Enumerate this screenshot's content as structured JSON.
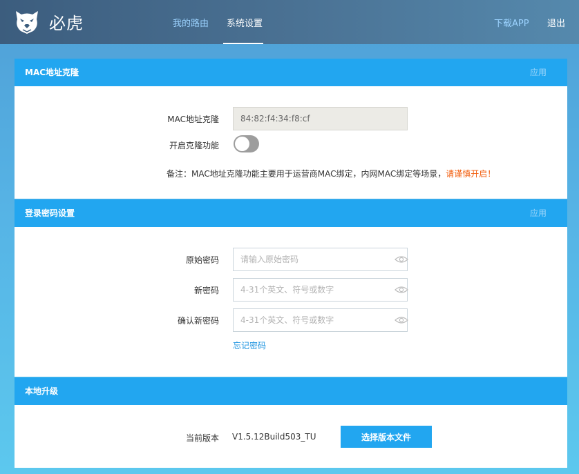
{
  "header": {
    "brand": "必虎",
    "nav": [
      "我的路由",
      "系统设置"
    ],
    "active_nav": "系统设置",
    "download_app": "下载APP",
    "logout": "退出"
  },
  "mac_panel": {
    "title": "MAC地址克隆",
    "apply": "应用",
    "mac_label": "MAC地址克隆",
    "mac_value": "84:82:f4:34:f8:cf",
    "clone_label": "开启克隆功能",
    "clone_enabled": false,
    "note_prefix": "备注：MAC地址克隆功能主要用于运营商MAC绑定，内网MAC绑定等场景，",
    "note_warning": "请谨慎开启！"
  },
  "password_panel": {
    "title": "登录密码设置",
    "apply": "应用",
    "old_label": "原始密码",
    "old_placeholder": "请输入原始密码",
    "new_label": "新密码",
    "new_placeholder": "4-31个英文、符号或数字",
    "confirm_label": "确认新密码",
    "confirm_placeholder": "4-31个英文、符号或数字",
    "forgot": "忘记密码"
  },
  "upgrade_panel": {
    "title": "本地升级",
    "version_label": "当前版本",
    "version_value": "V1.5.12Build503_TU",
    "choose_file": "选择版本文件"
  },
  "colors": {
    "accent": "#22a6f0",
    "warning": "#f25d0c",
    "link": "#1e94e0",
    "header": "#4a7193"
  }
}
